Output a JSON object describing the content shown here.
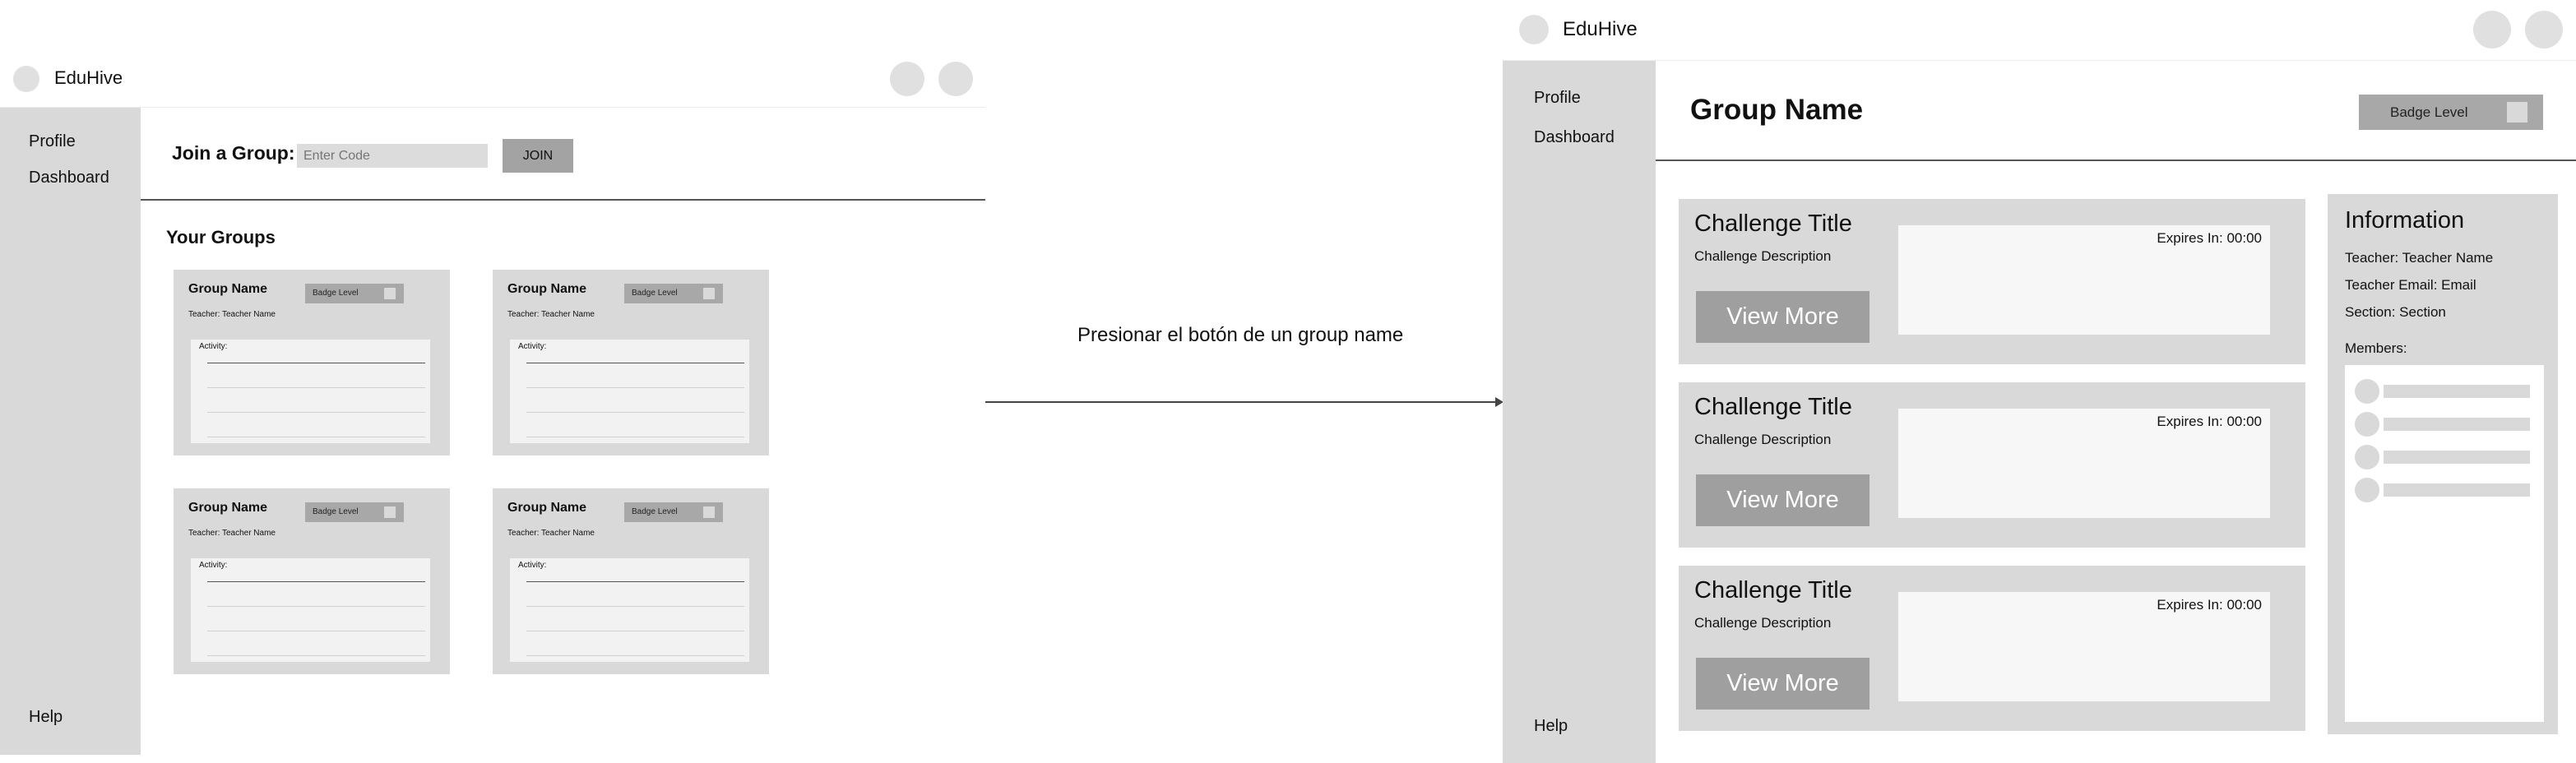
{
  "left_screen": {
    "app_title": "EduHive",
    "sidebar": {
      "profile": "Profile",
      "dashboard": "Dashboard",
      "help": "Help"
    },
    "join": {
      "label": "Join a Group:",
      "placeholder": "Enter Code",
      "button": "JOIN"
    },
    "groups_heading": "Your Groups",
    "groups": [
      {
        "name": "Group Name",
        "badge": "Badge Level",
        "teacher": "Teacher: Teacher Name",
        "activity_label": "Activity:"
      },
      {
        "name": "Group Name",
        "badge": "Badge Level",
        "teacher": "Teacher: Teacher Name",
        "activity_label": "Activity:"
      },
      {
        "name": "Group Name",
        "badge": "Badge Level",
        "teacher": "Teacher: Teacher Name",
        "activity_label": "Activity:"
      },
      {
        "name": "Group Name",
        "badge": "Badge Level",
        "teacher": "Teacher: Teacher Name",
        "activity_label": "Activity:"
      }
    ]
  },
  "transition_label": "Presionar el botón de un group name",
  "right_screen": {
    "app_title": "EduHive",
    "sidebar": {
      "profile": "Profile",
      "dashboard": "Dashboard",
      "help": "Help"
    },
    "group_name": "Group Name",
    "badge": "Badge Level",
    "challenges": [
      {
        "title": "Challenge Title",
        "description": "Challenge Description",
        "button": "View More",
        "expires": "Expires In: 00:00"
      },
      {
        "title": "Challenge Title",
        "description": "Challenge Description",
        "button": "View More",
        "expires": "Expires In: 00:00"
      },
      {
        "title": "Challenge Title",
        "description": "Challenge Description",
        "button": "View More",
        "expires": "Expires In: 00:00"
      }
    ],
    "info": {
      "heading": "Information",
      "teacher": "Teacher: Teacher Name",
      "email": "Teacher Email: Email",
      "section": "Section: Section",
      "members_label": "Members:"
    }
  },
  "colors": {
    "panel_gray": "#d9d9d9",
    "button_gray": "#9f9f9f",
    "badge_gray": "#a8a8a8"
  }
}
